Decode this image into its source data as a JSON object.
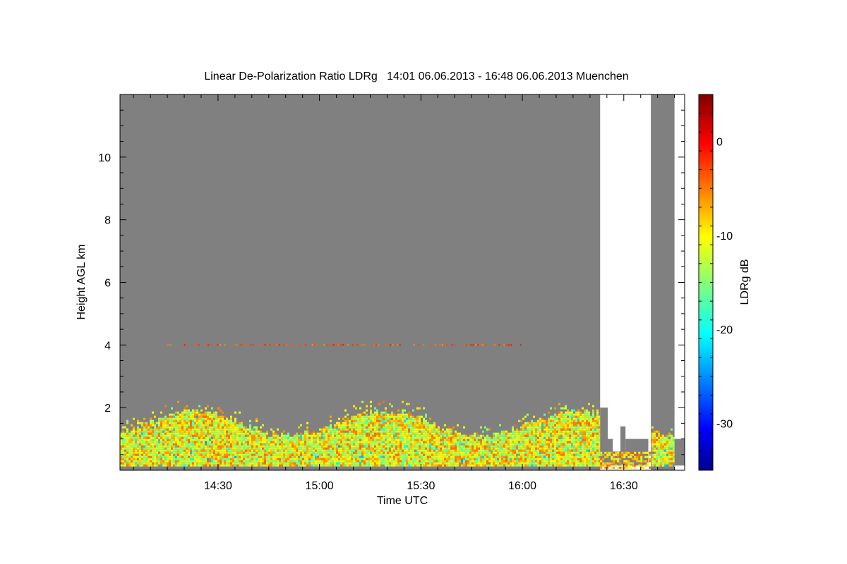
{
  "chart_data": {
    "type": "heatmap",
    "title": "Linear De-Polarization Ratio LDRg   14:01 06.06.2013 - 16:48 06.06.2013 Muenchen",
    "xlabel": "Time UTC",
    "ylabel": "Height AGL km",
    "x_range": [
      "14:01",
      "16:48"
    ],
    "y_range_km": [
      0,
      12
    ],
    "x_ticks": [
      "14:30",
      "15:00",
      "15:30",
      "16:00",
      "16:30"
    ],
    "y_ticks": [
      "2",
      "4",
      "6",
      "8",
      "10"
    ],
    "colorbar": {
      "label": "LDRg dB",
      "range": [
        -35,
        5
      ],
      "ticks": [
        "0",
        "-10",
        "-20",
        "-30"
      ],
      "colormap": "jet"
    },
    "colors": {
      "no_signal": "#808080",
      "no_data": "#ffffff",
      "background": "#ffffff"
    },
    "features": {
      "boundary_layer_top_km": 1.6,
      "boundary_layer_typical_LDRg_dB": -10,
      "thin_layer_height_km": 4.0,
      "thin_layer_time": [
        "14:15",
        "16:00"
      ],
      "thin_layer_LDRg_dB": -3,
      "no_data_gaps": [
        [
          "16:23",
          "16:38"
        ],
        [
          "16:45",
          "16:48"
        ]
      ]
    }
  }
}
